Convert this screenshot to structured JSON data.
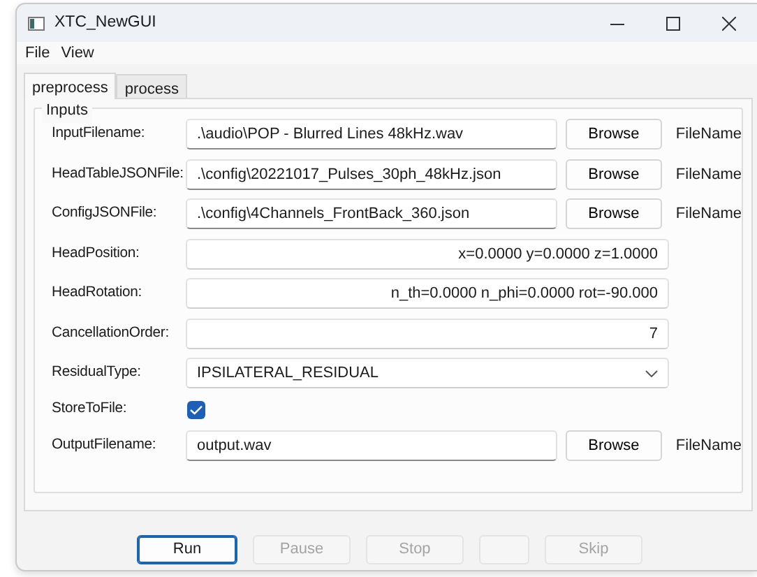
{
  "window": {
    "title": "XTC_NewGUI"
  },
  "menu": [
    "File",
    "View"
  ],
  "tabs": [
    {
      "label": "preprocess",
      "selected": true
    },
    {
      "label": "process",
      "selected": false
    }
  ],
  "group": {
    "title": "Inputs"
  },
  "rows": [
    {
      "kind": "file",
      "label": "InputFilename:",
      "value": ".\\audio\\POP - Blurred Lines 48kHz.wav",
      "button": "Browse",
      "note": "FileName"
    },
    {
      "kind": "file",
      "label": "HeadTableJSONFile:",
      "value": ".\\config\\20221017_Pulses_30ph_48kHz.json",
      "button": "Browse",
      "note": "FileName"
    },
    {
      "kind": "file",
      "label": "ConfigJSONFile:",
      "value": ".\\config\\4Channels_FrontBack_360.json",
      "button": "Browse",
      "note": "FileName"
    },
    {
      "kind": "text",
      "label": "HeadPosition:",
      "value": "x=0.0000 y=0.0000 z=1.0000"
    },
    {
      "kind": "text",
      "label": "HeadRotation:",
      "value": "n_th=0.0000 n_phi=0.0000 rot=-90.000"
    },
    {
      "kind": "text",
      "label": "CancellationOrder:",
      "value": "7"
    },
    {
      "kind": "combo",
      "label": "ResidualType:",
      "value": "IPSILATERAL_RESIDUAL"
    },
    {
      "kind": "checkbox",
      "label": "StoreToFile:",
      "checked": true
    },
    {
      "kind": "file",
      "label": "OutputFilename:",
      "value": "output.wav",
      "button": "Browse",
      "note": "FileName"
    }
  ],
  "buttons": [
    {
      "kind": "text",
      "label": "Run",
      "disabled": false
    },
    {
      "kind": "text",
      "label": "Pause",
      "disabled": true
    },
    {
      "kind": "text",
      "label": "Stop",
      "disabled": true
    },
    {
      "kind": "blank",
      "disabled": true
    },
    {
      "kind": "text",
      "label": "Skip",
      "disabled": true
    }
  ]
}
